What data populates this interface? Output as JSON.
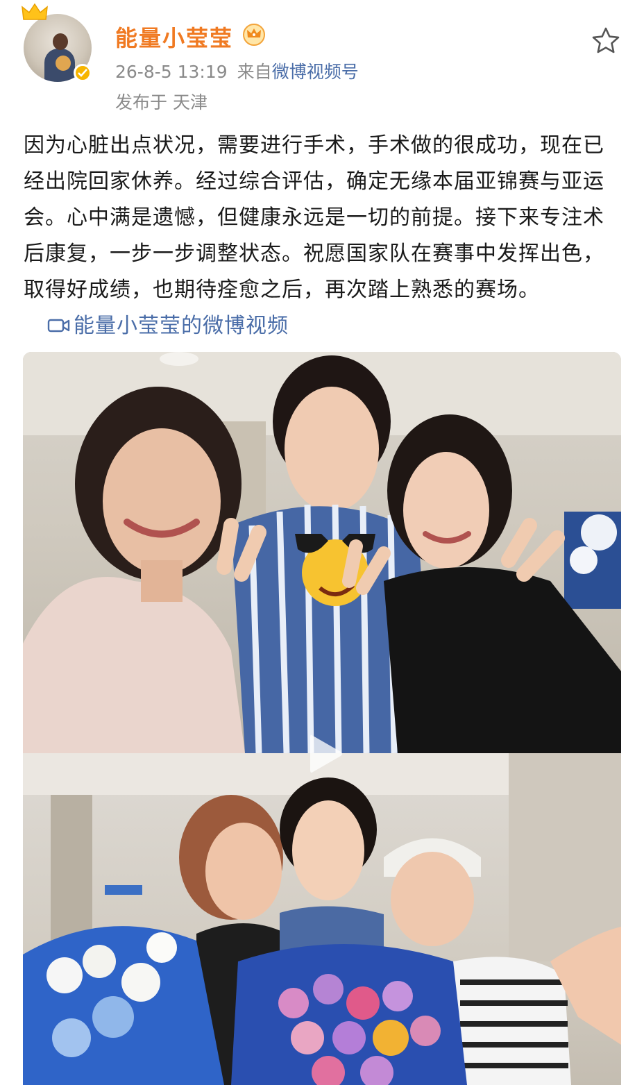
{
  "post": {
    "author": {
      "name": "能量小莹莹",
      "avatar_icon": "user-avatar",
      "badge_icon": "verified-badge-icon",
      "vip_icon": "vip-crown-icon"
    },
    "timestamp": "26-8-5 13:19",
    "source_prefix": "来自",
    "source_name": "微博视频号",
    "location": "发布于 天津",
    "body_text": "因为心脏出点状况，需要进行手术，手术做的很成功，现在已经出院回家休养。经过综合评估，确定无缘本届亚锦赛与亚运会。心中满是遗憾，但健康永远是一切的前提。接下来专注术后康复，一步一步调整状态。祝愿国家队在赛事中发挥出色，取得好成绩，也期待痊愈之后，再次踏上熟悉的赛场。",
    "video_link_label": "能量小莹莹的微博视频",
    "video_link_icon": "video-camera-icon"
  },
  "media": {
    "play_icon": "play-icon",
    "emoji_sticker": "sunglasses-emoji-sticker"
  },
  "colors": {
    "username": "#f07a22",
    "link": "#4a6da8",
    "meta": "#8a8a8a",
    "verified": "#f7b500"
  }
}
